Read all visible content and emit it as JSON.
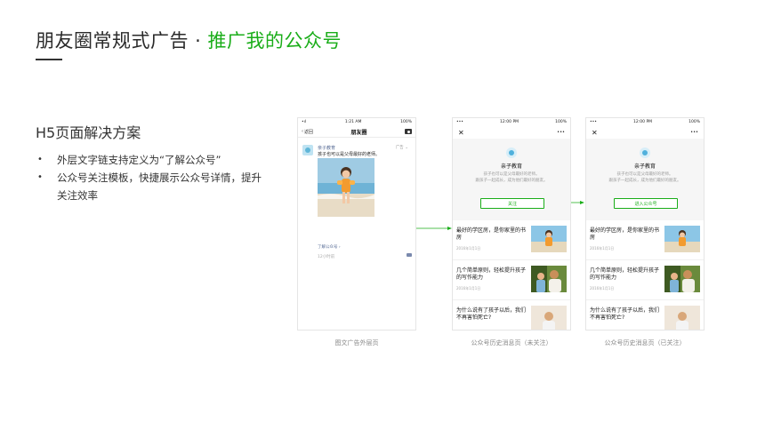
{
  "slide": {
    "title_main": "朋友圈常规式广告 · ",
    "title_accent": "推广我的公众号",
    "section_title": "H5页面解决方案",
    "bullets": [
      "外层文字链支持定义为“了解公众号”",
      "公众号关注模板，快捷展示公众号详情，提升关注效率"
    ]
  },
  "phone_moments": {
    "status_left": "•ıl",
    "status_time": "1:21 AM",
    "status_right": "100%",
    "back_label": "返回",
    "title": "朋友圈",
    "author": "亲子教育",
    "ad_tag": "广告 ⌄",
    "post_text": "孩子也可以是父母最好的老师。",
    "link_text": "了解公众号 ›",
    "time_text": "12小时前",
    "caption": "图文广告外层页"
  },
  "phone_unfollowed": {
    "status_left": "•••",
    "status_time": "12:00 PM",
    "status_right": "100%",
    "close": "✕",
    "more": "•••",
    "account_name": "亲子教育",
    "desc_line1": "孩子也可以是父母最好的老师。",
    "desc_line2": "跟孩子一起成长，成为他们最好的朋友。",
    "button_label": "关注",
    "articles": [
      {
        "title": "最好的学区房，是你家里的书房",
        "date": "2016年1月1日"
      },
      {
        "title": "几个简单原则，轻松提升孩子的写作能力",
        "date": "2016年1月1日"
      },
      {
        "title": "为什么说有了孩子以后，我们不再害怕死亡?",
        "date": ""
      }
    ],
    "caption": "公众号历史消息页（未关注）"
  },
  "phone_followed": {
    "status_left": "•••",
    "status_time": "12:00 PM",
    "status_right": "100%",
    "close": "✕",
    "more": "•••",
    "account_name": "亲子教育",
    "desc_line1": "孩子也可以是父母最好的老师。",
    "desc_line2": "跟孩子一起成长，成为他们最好的朋友。",
    "button_label": "进入公众号",
    "articles": [
      {
        "title": "最好的学区房，是你家里的书房",
        "date": "2016年1月1日"
      },
      {
        "title": "几个简单原则，轻松提升孩子的写作能力",
        "date": "2016年1月1日"
      },
      {
        "title": "为什么说有了孩子以后，我们不再害怕死亡?",
        "date": ""
      }
    ],
    "caption": "公众号历史消息页（已关注）"
  },
  "colors": {
    "accent": "#1aad19",
    "link": "#576b95"
  }
}
